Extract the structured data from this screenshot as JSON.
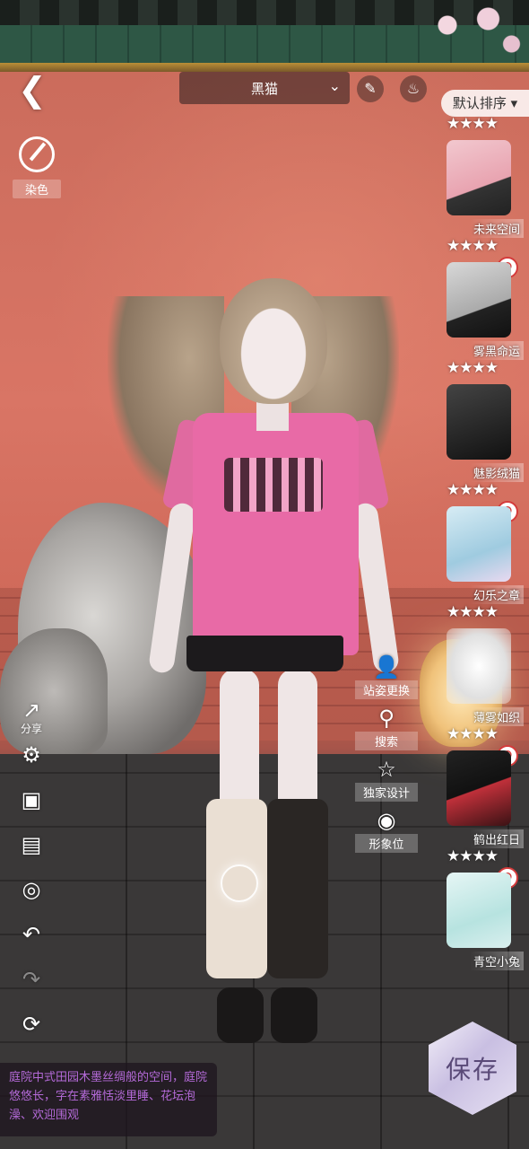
{
  "top": {
    "back_icon": "back-arrow-icon",
    "outfit_name": "黑猫",
    "dropdown_icon": "chevron-down-icon",
    "tool_a_icon": "pencil-icon",
    "tool_b_icon": "dress-icon",
    "sort_label": "默认排序"
  },
  "dye": {
    "label": "染色",
    "icon": "palette-icon"
  },
  "wardrobe": {
    "top_partial_stars": "★★★★",
    "items": [
      {
        "name": "未来空间",
        "stars": "★★★★",
        "banned": false
      },
      {
        "name": "雾黑命运",
        "stars": "★★★★",
        "banned": true
      },
      {
        "name": "魅影绒猫",
        "stars": "★★★★",
        "banned": false
      },
      {
        "name": "幻乐之章",
        "stars": "★★★★",
        "banned": true
      },
      {
        "name": "薄雾如织",
        "stars": "★★★★",
        "banned": false
      },
      {
        "name": "鹤出红日",
        "stars": "★★★★",
        "banned": true
      },
      {
        "name": "青空小兔",
        "stars": "",
        "banned": true
      }
    ]
  },
  "actions": {
    "pose": "站姿更换",
    "search": "搜索",
    "exclusive": "独家设计",
    "image_slot": "形象位"
  },
  "left_tools": {
    "share": "分享"
  },
  "description": "庭院中式田园木墨丝绸般的空间，庭院悠悠长，字在素雅恬淡里睡、花坛泡澡、欢迎围观",
  "save_label": "保存",
  "colors": {
    "shirt": "#e86aa6",
    "wall": "#d97565",
    "desc_text": "#b46ad8"
  }
}
